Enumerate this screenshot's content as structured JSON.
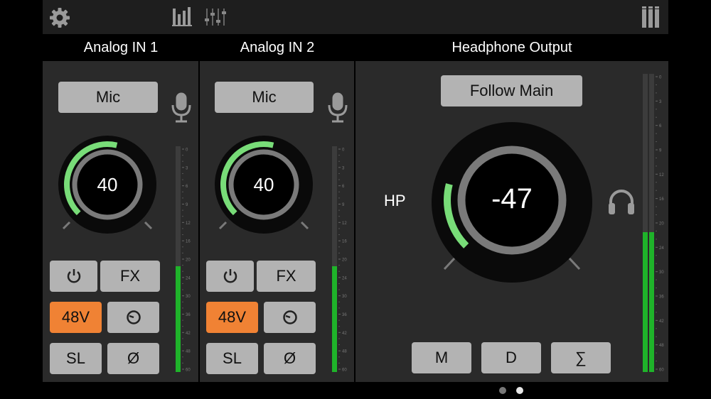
{
  "toolbar": {
    "settings_icon": "gear-icon",
    "meters_icon": "bar-meter-icon",
    "mixer_icon": "fader-icon",
    "device_icon": "device-grid-icon"
  },
  "channels": [
    {
      "title": "Analog IN 1",
      "input_type": "Mic",
      "gain": "40",
      "gain_fraction": 0.55,
      "meter_fraction": 0.47,
      "btn_power": "power-icon",
      "btn_fx": "FX",
      "btn_phantom": "48V",
      "btn_clock": "clock-icon",
      "btn_sl": "SL",
      "btn_phase": "Ø"
    },
    {
      "title": "Analog IN 2",
      "input_type": "Mic",
      "gain": "40",
      "gain_fraction": 0.55,
      "meter_fraction": 0.47,
      "btn_power": "power-icon",
      "btn_fx": "FX",
      "btn_phantom": "48V",
      "btn_clock": "clock-icon",
      "btn_sl": "SL",
      "btn_phase": "Ø"
    }
  ],
  "headphone": {
    "title": "Headphone Output",
    "follow_label": "Follow Main",
    "side_label": "HP",
    "level": "-47",
    "level_fraction": 0.22,
    "meter_fraction": 0.47,
    "btn_m": "M",
    "btn_d": "D",
    "btn_sum": "∑"
  },
  "meter_scale_small": [
    "0",
    "3",
    "6",
    "9",
    "12",
    "16",
    "20",
    "24",
    "30",
    "36",
    "42",
    "48",
    "60"
  ],
  "meter_scale_large": [
    "0",
    "3",
    "6",
    "9",
    "12",
    "16",
    "20",
    "24",
    "30",
    "36",
    "42",
    "48",
    "60"
  ],
  "page_indicator": {
    "count": 2,
    "active": 2
  },
  "colors": {
    "accent_green": "#78dc78",
    "meter_green": "#1fb32a",
    "phantom_orange": "#f08234",
    "button_gray": "#b3b3b3",
    "panel": "#2a2a2a"
  }
}
